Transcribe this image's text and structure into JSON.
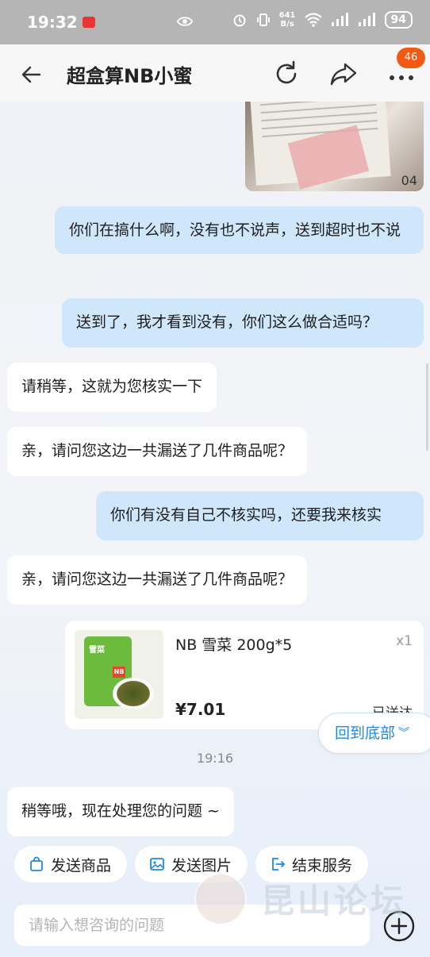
{
  "status_bar": {
    "time": "19:32",
    "net_speed_value": "641",
    "net_speed_unit": "B/s",
    "battery": "94"
  },
  "header": {
    "title": "超盒算NB小蜜",
    "badge_count": "46"
  },
  "messages": [
    {
      "dir": "out",
      "text": "你们在搞什么啊，没有也不说声，送到超时也不说"
    },
    {
      "dir": "out",
      "text": "送到了，我才看到没有，你们这么做合适吗？"
    },
    {
      "dir": "in",
      "text": "请稍等，这就为您核实一下"
    },
    {
      "dir": "in",
      "text": "亲，请问您这边一共漏送了几件商品呢？"
    },
    {
      "dir": "out",
      "text": "你们有没有自己不核实吗，还要我来核实"
    },
    {
      "dir": "in",
      "text": "亲，请问您这边一共漏送了几件商品呢？"
    },
    {
      "dir": "in",
      "text": "稍等哦，现在处理您的问题 ~"
    }
  ],
  "photo_message": {
    "visible_number": "04"
  },
  "product_card": {
    "name": "NB 雪菜 200g*5",
    "quantity": "x1",
    "price": "¥7.01",
    "status": "已送达"
  },
  "back_to_bottom_label": "回到底部",
  "timestamp": "19:16",
  "quick_actions": [
    {
      "label": "发送商品",
      "icon": "bag-icon"
    },
    {
      "label": "发送图片",
      "icon": "image-icon"
    },
    {
      "label": "结束服务",
      "icon": "exit-icon"
    }
  ],
  "input": {
    "placeholder": "请输入想咨询的问题",
    "value": ""
  },
  "watermark": {
    "text": "昆山论坛"
  },
  "colors": {
    "outgoing_bubble": "#cfe6fb",
    "incoming_bubble": "#ffffff",
    "accent_blue": "#1e88e5",
    "badge_orange": "#f25a14"
  }
}
